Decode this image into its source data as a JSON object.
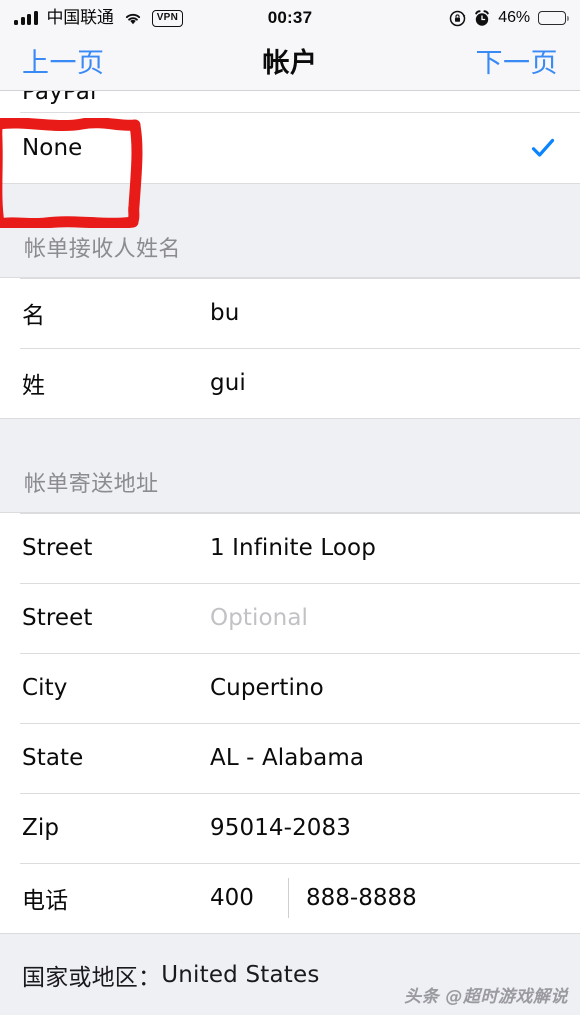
{
  "status_bar": {
    "carrier": "中国联通",
    "signal_icon": "signal-bars-icon",
    "wifi_icon": "wifi-icon",
    "vpn_label": "VPN",
    "time": "00:37",
    "rotation_lock_icon": "rotation-lock-icon",
    "alarm_icon": "alarm-clock-icon",
    "battery_percent": "46%",
    "battery_level": 46
  },
  "nav_bar": {
    "prev_label": "上一页",
    "title": "帐户",
    "next_label": "下一页",
    "tint_color": "#3a8af6"
  },
  "payment_section": {
    "clipped_row_label": "PayPal",
    "selected_row": {
      "label": "None",
      "checked": true,
      "check_icon": "checkmark-icon",
      "check_color": "#0a84ff"
    }
  },
  "name_section": {
    "header": "帐单接收人姓名",
    "rows": [
      {
        "label": "名",
        "value": "bu",
        "placeholder": false
      },
      {
        "label": "姓",
        "value": "gui",
        "placeholder": false
      }
    ]
  },
  "address_section": {
    "header": "帐单寄送地址",
    "rows": [
      {
        "label": "Street",
        "value": "1 Infinite Loop",
        "placeholder": false
      },
      {
        "label": "Street",
        "value": "Optional",
        "placeholder": true
      },
      {
        "label": "City",
        "value": "Cupertino",
        "placeholder": false
      },
      {
        "label": "State",
        "value": "AL - Alabama",
        "placeholder": false
      },
      {
        "label": "Zip",
        "value": "95014-2083",
        "placeholder": false
      }
    ],
    "phone_row": {
      "label": "电话",
      "country_code": "400",
      "number": "888-8888"
    }
  },
  "footer": {
    "country_label": "国家或地区：",
    "country_value": "United States",
    "watermark": "头条 @超时游戏解说"
  },
  "annotation": {
    "type": "hand-drawn-rectangle",
    "color": "#e81b18",
    "target": "None"
  }
}
